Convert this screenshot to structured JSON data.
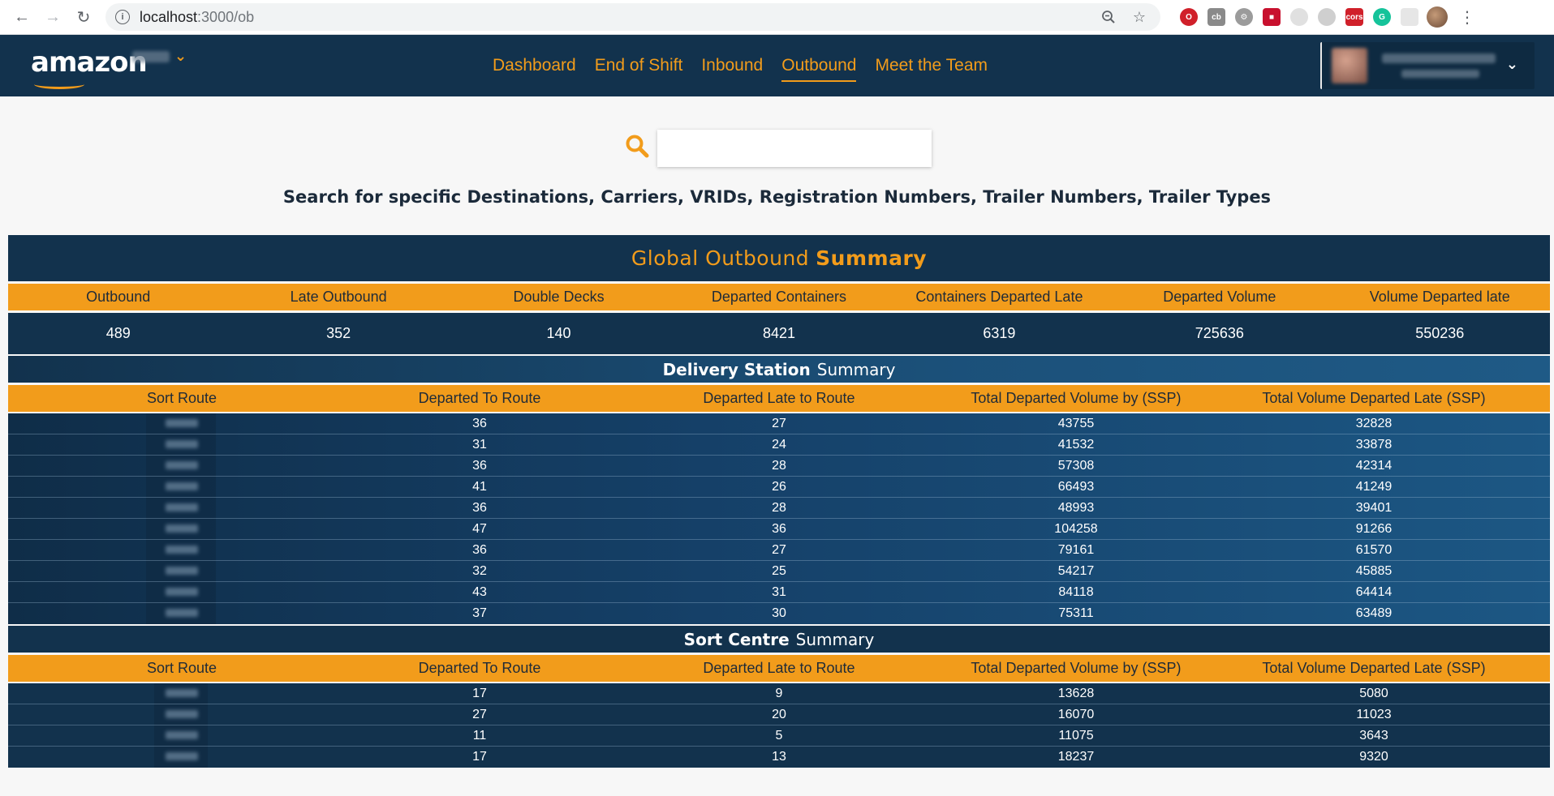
{
  "browser": {
    "url_host": "localhost",
    "url_path": ":3000/ob"
  },
  "header": {
    "logo": "amazon",
    "nav": [
      "Dashboard",
      "End of Shift",
      "Inbound",
      "Outbound",
      "Meet the Team"
    ],
    "active_nav": "Outbound"
  },
  "search": {
    "placeholder": "",
    "value": "",
    "hint": "Search for specific Destinations, Carriers, VRIDs, Registration Numbers, Trailer Numbers, Trailer Types"
  },
  "global": {
    "title_prefix": "Global Outbound",
    "title_bold": "Summary",
    "headers": [
      "Outbound",
      "Late Outbound",
      "Double Decks",
      "Departed Containers",
      "Containers Departed Late",
      "Departed Volume",
      "Volume Departed late"
    ],
    "values": [
      "489",
      "352",
      "140",
      "8421",
      "6319",
      "725636",
      "550236"
    ]
  },
  "delivery_station": {
    "title_bold": "Delivery Station",
    "title_rest": "Summary",
    "headers": [
      "Sort Route",
      "Departed To Route",
      "Departed Late to Route",
      "Total Departed Volume by (SSP)",
      "Total Volume Departed Late (SSP)"
    ],
    "rows": [
      [
        "36",
        "27",
        "43755",
        "32828"
      ],
      [
        "31",
        "24",
        "41532",
        "33878"
      ],
      [
        "36",
        "28",
        "57308",
        "42314"
      ],
      [
        "41",
        "26",
        "66493",
        "41249"
      ],
      [
        "36",
        "28",
        "48993",
        "39401"
      ],
      [
        "47",
        "36",
        "104258",
        "91266"
      ],
      [
        "36",
        "27",
        "79161",
        "61570"
      ],
      [
        "32",
        "25",
        "54217",
        "45885"
      ],
      [
        "43",
        "31",
        "84118",
        "64414"
      ],
      [
        "37",
        "30",
        "75311",
        "63489"
      ]
    ]
  },
  "sort_centre": {
    "title_bold": "Sort Centre",
    "title_rest": "Summary",
    "headers": [
      "Sort Route",
      "Departed To Route",
      "Departed Late to Route",
      "Total Departed Volume by (SSP)",
      "Total Volume Departed Late (SSP)"
    ],
    "rows": [
      [
        "17",
        "9",
        "13628",
        "5080"
      ],
      [
        "27",
        "20",
        "16070",
        "11023"
      ],
      [
        "11",
        "5",
        "11075",
        "3643"
      ],
      [
        "17",
        "13",
        "18237",
        "9320"
      ]
    ]
  },
  "colors": {
    "navy": "#12324d",
    "orange": "#f29c1b"
  }
}
